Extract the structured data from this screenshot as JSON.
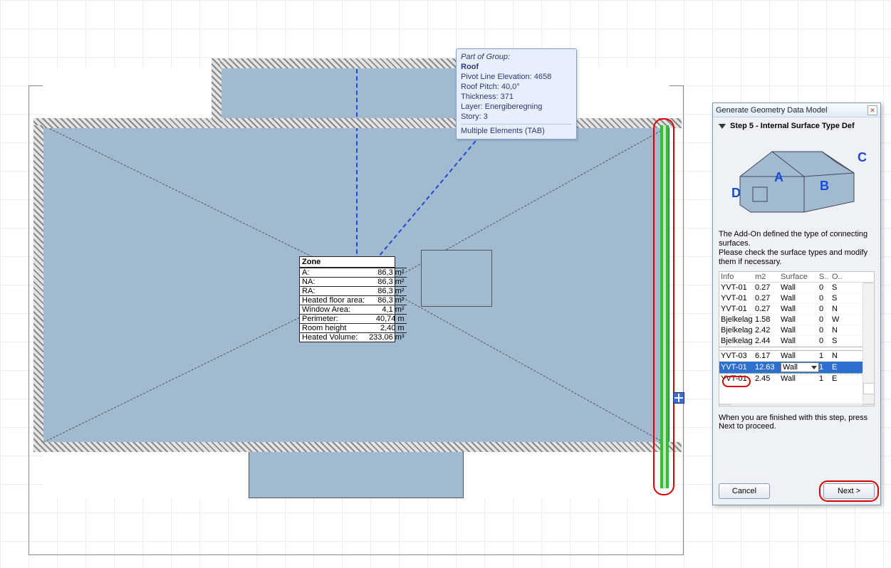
{
  "tooltip": {
    "group_label": "Part of Group:",
    "group_name": "Roof",
    "lines": [
      "Pivot Line Elevation: 4658",
      "Roof Pitch: 40,0°",
      "Thickness: 371",
      "Layer:  Energiberegning",
      "Story: 3"
    ],
    "tab_hint": "Multiple Elements (TAB)"
  },
  "zone": {
    "title": "Zone",
    "rows": [
      {
        "k": "A:",
        "v": "86,3 m²"
      },
      {
        "k": "NA:",
        "v": "86,3 m²"
      },
      {
        "k": "RA:",
        "v": "86,3 m²"
      },
      {
        "k": "Heated floor area:",
        "v": "86,3 m²"
      },
      {
        "k": "Window Area:",
        "v": "4,1 m²"
      },
      {
        "k": "Perimeter:",
        "v": "40,74 m"
      },
      {
        "k": "Room height",
        "v": "2,40 m"
      },
      {
        "k": "Heated Volume:",
        "v": "233,06 m³"
      }
    ]
  },
  "dialog": {
    "title": "Generate Geometry Data Model",
    "step": "Step 5 - Internal Surface Type Def",
    "diagram_labels": {
      "A": "A",
      "B": "B",
      "C": "C",
      "D": "D"
    },
    "desc_line1": "The Add-On defined the type of connecting surfaces.",
    "desc_line2": "Please check the surface types and modify them if necessary.",
    "columns": {
      "info": "Info",
      "m2": "m2",
      "surface": "Surface",
      "s": "S..",
      "o": "O.."
    },
    "rows": [
      {
        "info": "YVT-01",
        "m2": "0.27",
        "surface": "Wall",
        "s": "0",
        "o": "S"
      },
      {
        "info": "YVT-01",
        "m2": "0.27",
        "surface": "Wall",
        "s": "0",
        "o": "S"
      },
      {
        "info": "YVT-01",
        "m2": "0.27",
        "surface": "Wall",
        "s": "0",
        "o": "N"
      },
      {
        "info": "Bjelkelag",
        "m2": "1.58",
        "surface": "Wall",
        "s": "0",
        "o": "W"
      },
      {
        "info": "Bjelkelag",
        "m2": "2.42",
        "surface": "Wall",
        "s": "0",
        "o": "N"
      },
      {
        "info": "Bjelkelag",
        "m2": "2.44",
        "surface": "Wall",
        "s": "0",
        "o": "S"
      },
      {
        "sep": true
      },
      {
        "info": "YVT-03",
        "m2": "6.17",
        "surface": "Wall",
        "s": "1",
        "o": "N"
      },
      {
        "info": "YVT-01",
        "m2": "12.63",
        "surface": "Wall",
        "s": "1",
        "o": "E",
        "selected": true
      },
      {
        "info": "YVT-01",
        "m2": "2.45",
        "surface": "Wall",
        "s": "1",
        "o": "E"
      }
    ],
    "finish_text": "When you are finished with this step, press Next to proceed.",
    "cancel": "Cancel",
    "next": "Next >"
  }
}
